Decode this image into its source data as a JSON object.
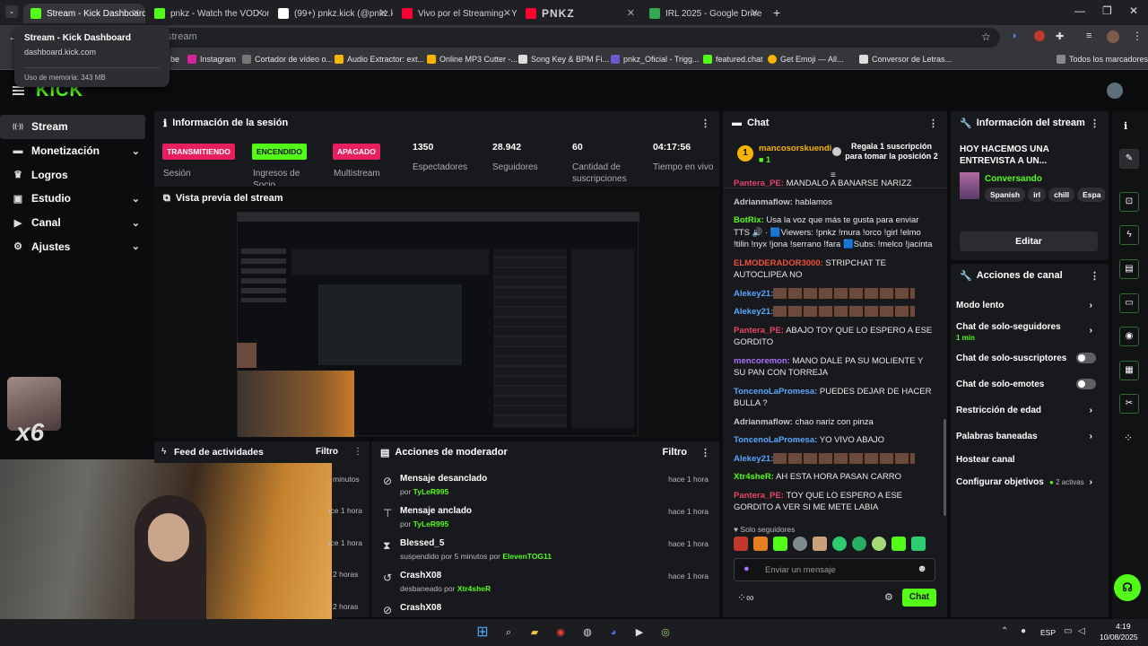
{
  "browser": {
    "tabs": [
      {
        "title": "Stream - Kick Dashboard",
        "color": "#53fc18"
      },
      {
        "title": "pnkz - Watch the VOD on",
        "color": "#53fc18"
      },
      {
        "title": "(99+) pnkz.kick (@pnkz.ki",
        "color": "#ffffff"
      },
      {
        "title": "Vivo por el Streaming - Yo",
        "color": "#ff0033"
      },
      {
        "title": "PNKZ ",
        "color": "#ff0033"
      },
      {
        "title": "IRL 2025 - Google Drive",
        "color": "#34a853"
      }
    ],
    "url": "stream",
    "tooltip": {
      "title": "Stream - Kick Dashboard",
      "domain": "dashboard.kick.com",
      "memory": "Uso de memoria: 343 MB"
    },
    "bookmarks": [
      "be",
      "Instagram",
      "Cortador de vídeo o...",
      "Audio Extractor: ext...",
      "Online MP3 Cutter -...",
      "Song Key & BPM Fi...",
      "pnkz_Oficial - Trigg...",
      "featured.chat",
      "Get Emoji — All...",
      "Conversor de Letras..."
    ],
    "bookmarks_all": "Todos los marcadores"
  },
  "brand": "KICK",
  "sidebar": [
    {
      "label": "Stream",
      "icon": "stream-icon",
      "glyph": "((·))"
    },
    {
      "label": "Monetización",
      "icon": "money-icon",
      "glyph": "▬"
    },
    {
      "label": "Logros",
      "icon": "trophy-icon",
      "glyph": "♛"
    },
    {
      "label": "Estudio",
      "icon": "studio-icon",
      "glyph": "▣"
    },
    {
      "label": "Canal",
      "icon": "channel-icon",
      "glyph": "▶"
    },
    {
      "label": "Ajustes",
      "icon": "settings-icon",
      "glyph": "⚙"
    }
  ],
  "session": {
    "title": "Información de la sesión",
    "badges": [
      {
        "status": "TRANSMITIENDO",
        "label": "Sesión",
        "color": "#e81f5e"
      },
      {
        "status": "ENCENDIDO",
        "label": "Ingresos de Socio",
        "color": "#53fc18"
      },
      {
        "status": "APAGADO",
        "label": "Multistream",
        "color": "#e81f5e"
      }
    ],
    "stats": [
      {
        "value": "1350",
        "label": "Espectadores"
      },
      {
        "value": "28.942",
        "label": "Seguidores"
      },
      {
        "value": "60",
        "label": "Cantidad de suscripciones"
      },
      {
        "value": "04:17:56",
        "label": "Tiempo en vivo"
      }
    ]
  },
  "preview": {
    "title": "Vista previa del stream",
    "overlay": "x6"
  },
  "activity": {
    "title": "Feed de actividades",
    "filter": "Filtro",
    "times": [
      "minutos",
      "hace 1 hora",
      "hace 1 hora",
      "2 horas",
      "2 horas"
    ]
  },
  "modactions": {
    "title": "Acciones de moderador",
    "filter": "Filtro",
    "rows": [
      {
        "title": "Mensaje desanclado",
        "prefix": "por",
        "user": "TyLeR995",
        "time": "hace 1 hora",
        "icon": "unpin-icon",
        "glyph": "⊘"
      },
      {
        "title": "Mensaje anclado",
        "prefix": "por",
        "user": "TyLeR995",
        "time": "hace 1 hora",
        "icon": "pin-icon",
        "glyph": "⊤"
      },
      {
        "title": "Blessed_5",
        "prefix": "suspendido por 5 minutos por",
        "user": "ElevenTOG11",
        "time": "hace 1 hora",
        "icon": "hourglass-icon",
        "glyph": "⧗"
      },
      {
        "title": "CrashX08",
        "prefix": "desbaneado por",
        "user": "Xtr4sheR",
        "time": "hace 1 hora",
        "icon": "unban-icon",
        "glyph": "↺"
      },
      {
        "title": "CrashX08",
        "prefix": "",
        "user": "",
        "time": "",
        "icon": "ban-icon",
        "glyph": "⊘"
      }
    ]
  },
  "chat": {
    "title": "Chat",
    "sub_user": "mancosorskuendi",
    "sub_count": "1",
    "goal": "Regala 1 suscripción para tomar la posición 2",
    "messages": [
      {
        "user": "Pantera_PE:",
        "color": "#e8436d",
        "text": " MANDALO A BANARSE NARIZZ",
        "emotes": false
      },
      {
        "user": "Adrianmaflow:",
        "color": "#c7c7c7",
        "text": " hablamos",
        "emotes": false
      },
      {
        "user": "BotRix:",
        "color": "#53fc18",
        "text": " Usa la voz que más te gusta para enviar TTS 🔊 · 🟦Viewers: !pnkz !mura !orco !girl !elmo !tilin !nyx !jona !serrano !fara 🟦Subs: !melco !jacinta",
        "emotes": false
      },
      {
        "user": "ELMODERADOR3000:",
        "color": "#f0513c",
        "text": " STRIPCHAT TE AUTOCLIPEA NO",
        "emotes": false
      },
      {
        "user": "Alekey21:",
        "color": "#58a6ff",
        "text": " ",
        "emotes": true
      },
      {
        "user": "Alekey21:",
        "color": "#58a6ff",
        "text": " ",
        "emotes": true
      },
      {
        "user": "Pantera_PE:",
        "color": "#e8436d",
        "text": " ABAJO TOY QUE LO ESPERO A ESE GORDITO",
        "emotes": false
      },
      {
        "user": "mencoremon:",
        "color": "#a970ff",
        "text": " MANO DALE PA SU MOLIENTE Y SU PAN CON TORREJA",
        "emotes": false
      },
      {
        "user": "ToncenoLaPromesa:",
        "color": "#58a6ff",
        "text": " PUEDES DEJAR DE HACER BULLA ?",
        "emotes": false
      },
      {
        "user": "Adrianmaflow:",
        "color": "#c7c7c7",
        "text": " chao nariz con pinza",
        "emotes": false
      },
      {
        "user": "ToncenoLaPromesa:",
        "color": "#58a6ff",
        "text": " YO VIVO ABAJO",
        "emotes": false
      },
      {
        "user": "Alekey21:",
        "color": "#58a6ff",
        "text": " ",
        "emotes": true
      },
      {
        "user": "Xtr4sheR:",
        "color": "#53fc18",
        "text": " AH ESTA HORA PASAN CARRO",
        "emotes": false
      },
      {
        "user": "Pantera_PE:",
        "color": "#e8436d",
        "text": " TOY QUE LO ESPERO A ESE GORDITO A VER SI ME METE LABIA",
        "emotes": false
      }
    ],
    "followers_only": "Solo seguidores",
    "placeholder": "Enviar un mensaje",
    "send": "Chat"
  },
  "streaminfo": {
    "title": "Información del stream",
    "stream_title": "HOY HACEMOS UNA ENTREVISTA A UN...",
    "category": "Conversando",
    "tags": [
      "Spanish",
      "irl",
      "chill",
      "Espa"
    ],
    "edit": "Editar"
  },
  "channelactions": {
    "title": "Acciones de canal",
    "items": [
      {
        "label": "Modo lento",
        "sub": "",
        "control": "chevron"
      },
      {
        "label": "Chat de solo-seguidores",
        "sub": "1 min",
        "control": "chevron"
      },
      {
        "label": "Chat de solo-suscriptores",
        "sub": "",
        "control": "toggle"
      },
      {
        "label": "Chat de solo-emotes",
        "sub": "",
        "control": "toggle"
      },
      {
        "label": "Restricción de edad",
        "sub": "",
        "control": "chevron"
      },
      {
        "label": "Palabras baneadas",
        "sub": "",
        "control": "chevron"
      },
      {
        "label": "Hostear canal",
        "sub": "",
        "control": "none"
      },
      {
        "label": "Configurar objetivos",
        "sub": "2 activas",
        "control": "chevron"
      }
    ]
  },
  "taskbar": {
    "lang": "ESP",
    "time": "4:19",
    "date": "10/08/2025"
  },
  "colors": {
    "accent": "#53fc18",
    "live": "#e81f5e",
    "panel": "#18191c",
    "background": "#0b0c0e"
  }
}
